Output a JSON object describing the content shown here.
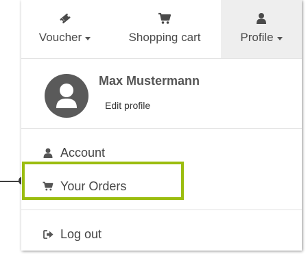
{
  "topnav": {
    "voucher": {
      "label": "Voucher",
      "icon": "ticket-icon"
    },
    "cart": {
      "label": "Shopping cart",
      "icon": "shopping-cart-icon"
    },
    "profile": {
      "label": "Profile",
      "icon": "user-icon",
      "active": true
    }
  },
  "user": {
    "name": "Max Mustermann",
    "edit_label": "Edit profile",
    "avatar_icon": "user-avatar-icon"
  },
  "menu": {
    "account": {
      "label": "Account",
      "icon": "user-icon"
    },
    "orders": {
      "label": "Your Orders",
      "icon": "shopping-cart-icon",
      "highlighted": true
    },
    "logout": {
      "label": "Log out",
      "icon": "sign-out-icon"
    }
  },
  "colors": {
    "highlight": "#9bbd0f",
    "callout": "#3d3d3d",
    "active_tab_bg": "#eeeeee",
    "avatar_bg": "#5a5a5a"
  }
}
